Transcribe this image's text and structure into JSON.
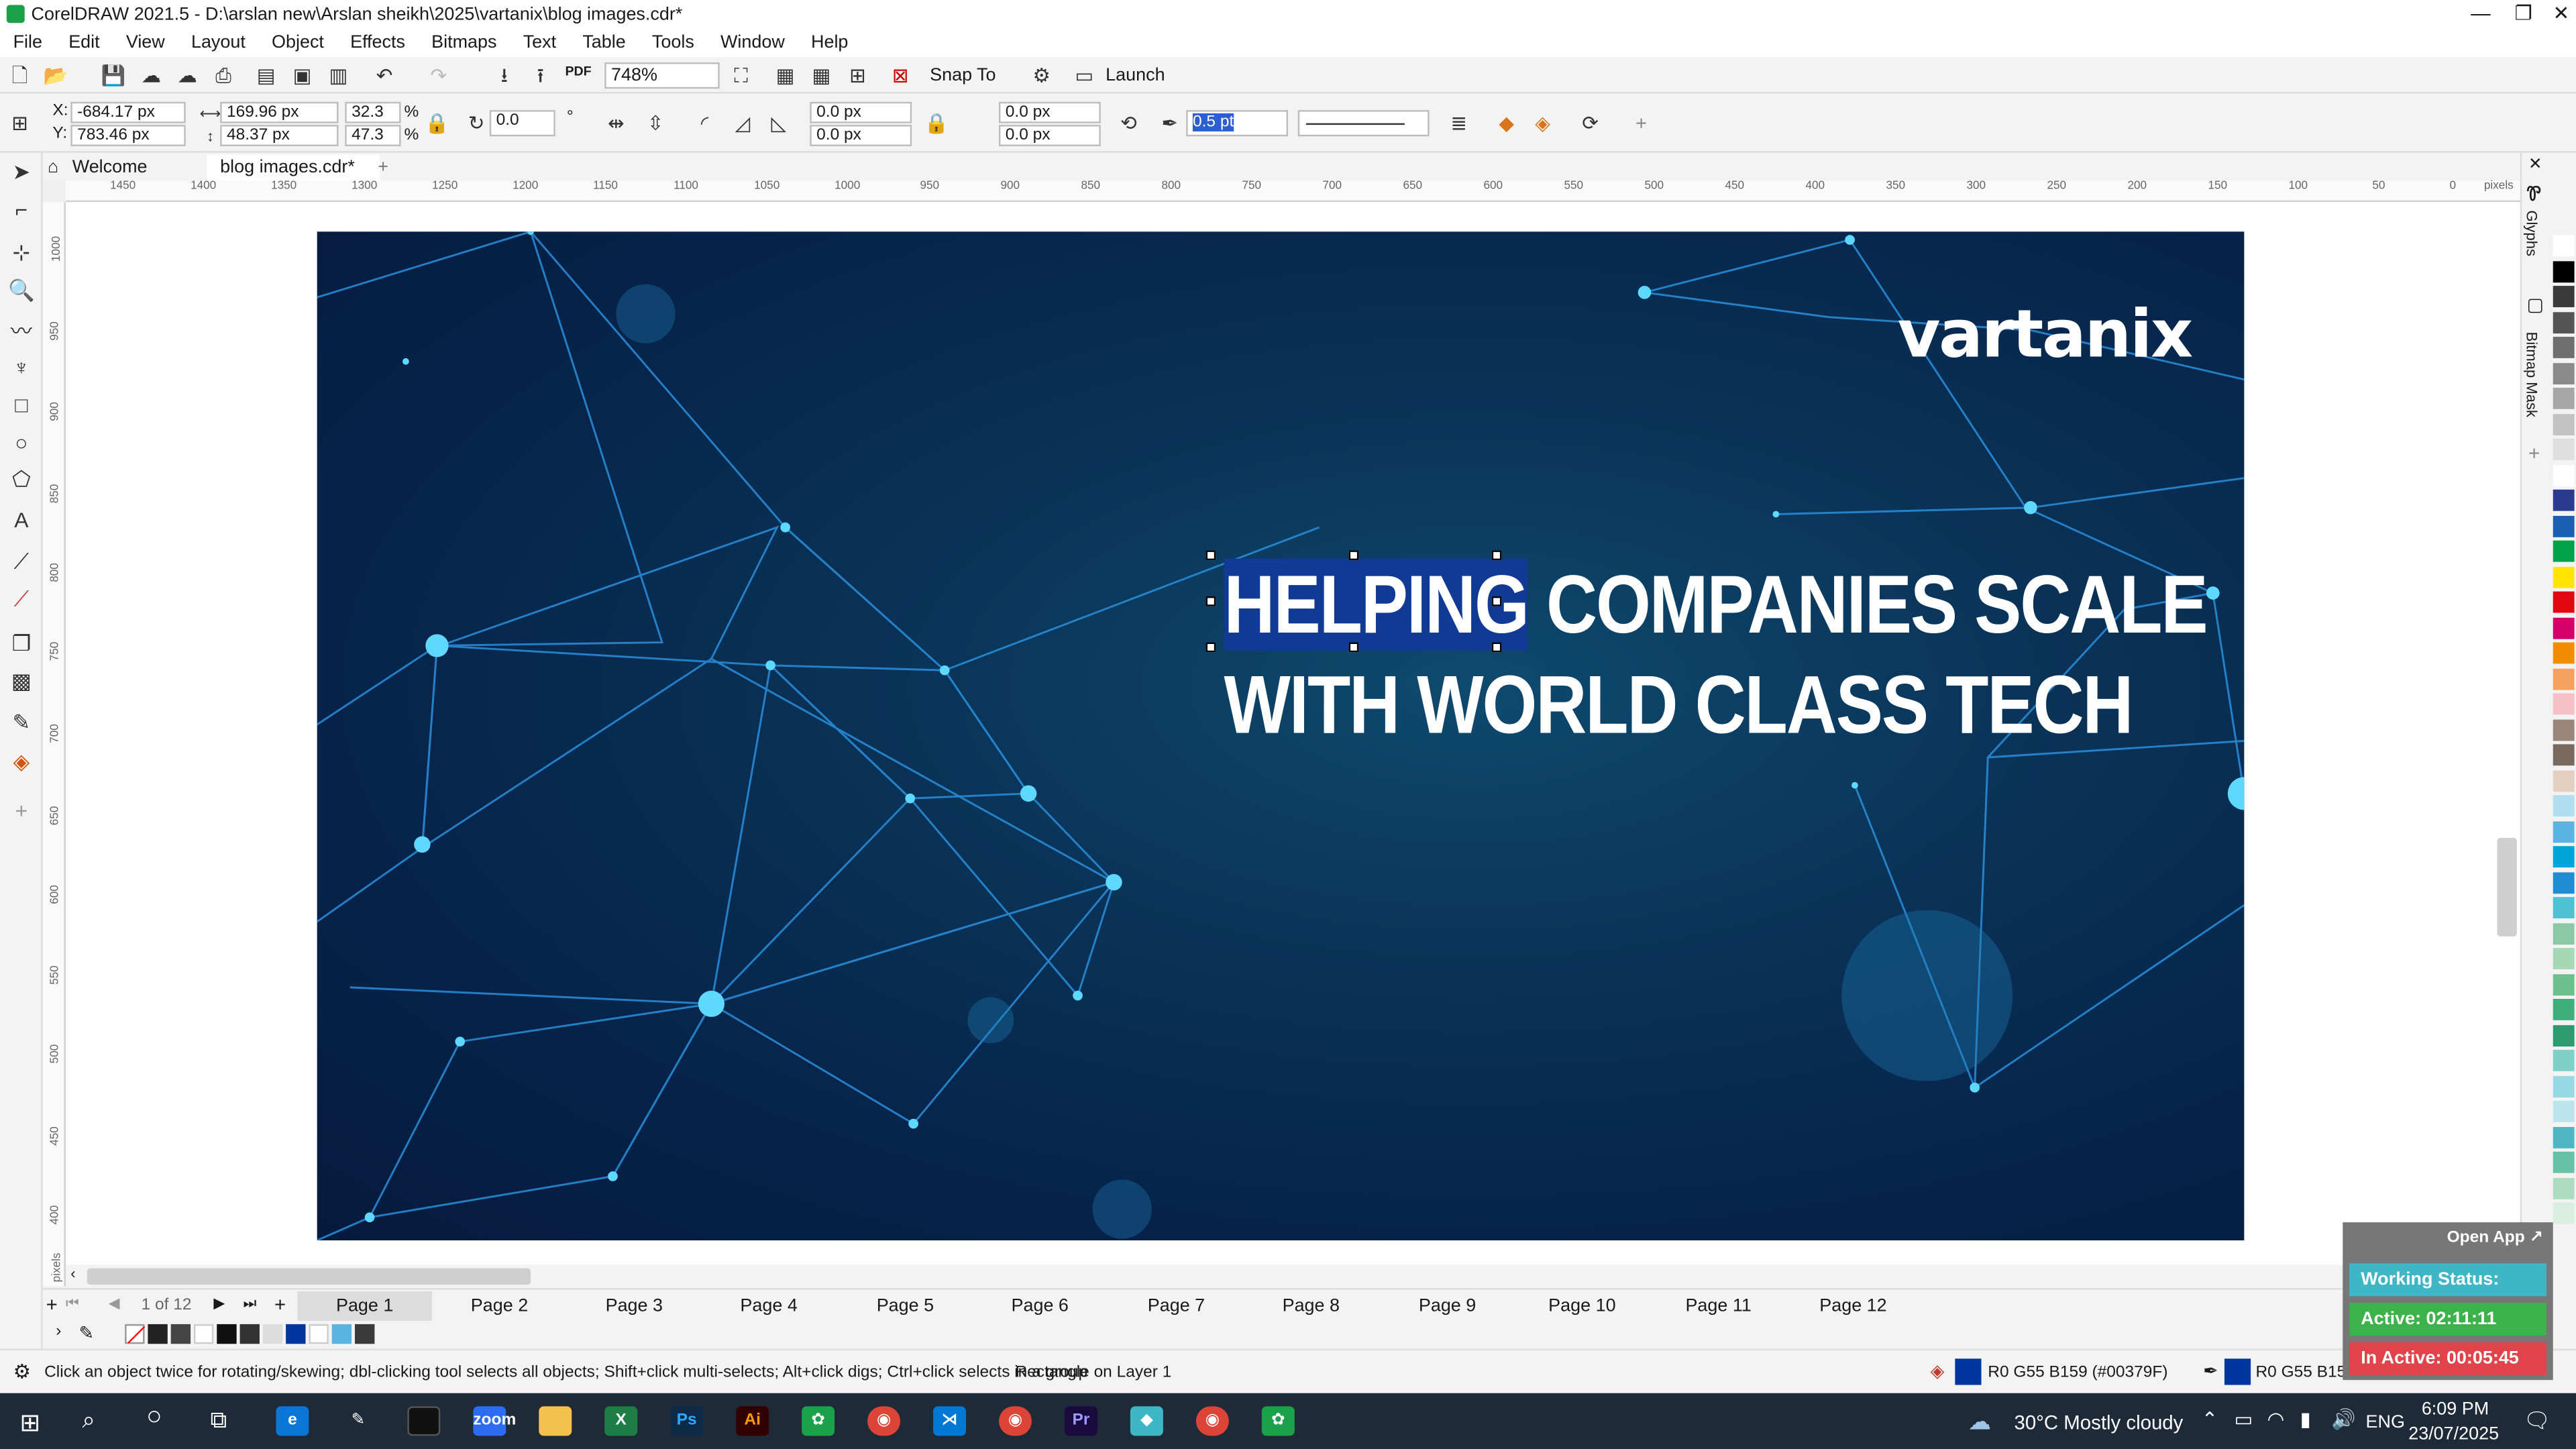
{
  "window": {
    "title": "CorelDRAW 2021.5 - D:\\arslan new\\Arslan sheikh\\2025\\vartanix\\blog images.cdr*",
    "controls": [
      "—",
      "❐",
      "✕"
    ]
  },
  "menu": [
    "File",
    "Edit",
    "View",
    "Layout",
    "Object",
    "Effects",
    "Bitmaps",
    "Text",
    "Table",
    "Tools",
    "Window",
    "Help"
  ],
  "toolbar": {
    "zoom": "748%",
    "snap_to": "Snap To",
    "launch": "Launch",
    "pdf_label": "PDF"
  },
  "property_bar": {
    "x": "-684.17 px",
    "y": "783.46 px",
    "x_label": "X:",
    "y_label": "Y:",
    "width": "169.96 px",
    "height": "48.37 px",
    "scale_w": "32.3",
    "scale_h": "47.3",
    "percent": "%",
    "rotation": "0.0",
    "degree": "°",
    "pos_a1": "0.0 px",
    "pos_a2": "0.0 px",
    "pos_b1": "0.0 px",
    "pos_b2": "0.0 px",
    "outline_width": "0.5 pt"
  },
  "doc_tabs": [
    "Welcome Screen",
    "blog images.cdr*"
  ],
  "ruler_h": [
    "1450",
    "1400",
    "1350",
    "1300",
    "1250",
    "1200",
    "1150",
    "1100",
    "1050",
    "1000",
    "950",
    "900",
    "850",
    "800",
    "750",
    "700",
    "650",
    "600",
    "550",
    "500",
    "450",
    "400",
    "350",
    "300",
    "250",
    "200",
    "150",
    "100",
    "50",
    "0"
  ],
  "ruler_h_unit": "pixels",
  "ruler_v": [
    "1000",
    "950",
    "900",
    "850",
    "800",
    "750",
    "700",
    "650",
    "600",
    "550",
    "500",
    "450",
    "400"
  ],
  "ruler_v_unit": "pixels",
  "artboard": {
    "logo": "vartanix",
    "headline_line1_selected": "HELPING",
    "headline_line1_rest": "COMPANIES SCALE",
    "headline_line2": "WITH WORLD CLASS TECH"
  },
  "pages": {
    "counter": "1 of 12",
    "tabs": [
      "Page 1",
      "Page 2",
      "Page 3",
      "Page 4",
      "Page 5",
      "Page 6",
      "Page 7",
      "Page 8",
      "Page 9",
      "Page 10",
      "Page 11",
      "Page 12"
    ],
    "active": "Page 1"
  },
  "status": {
    "hint": "Click an object twice for rotating/skewing; dbl-clicking tool selects all objects; Shift+click multi-selects; Alt+click digs; Ctrl+click selects in a group",
    "object": "Rectangle on Layer 1",
    "fill": "R0 G55 B159 (#00379F)",
    "outline": "R0 G55 B159",
    "fill_color": "#00379F"
  },
  "docker": {
    "glyphs": "Glyphs",
    "bitmap_mask": "Bitmap Mask"
  },
  "tracker": {
    "open_app": "Open App ↗",
    "working_status": "Working Status: Active",
    "active": "Active: 02:11:11",
    "inactive": "In Active: 00:05:45"
  },
  "taskbar": {
    "weather": "30°C  Mostly cloudy",
    "lang": "ENG",
    "time": "6:09 PM",
    "date": "23/07/2025",
    "apps": [
      "zoom",
      "Ps",
      "Ai",
      "Pr"
    ]
  },
  "palette_colors": [
    "#ffffff",
    "#000000",
    "#3a3a3a",
    "#555555",
    "#6e6e6e",
    "#8a8a8a",
    "#a6a6a6",
    "#c2c2c2",
    "#dedede",
    "#ffffff",
    "#2b3b8f",
    "#1b5fb3",
    "#00a14b",
    "#ffe600",
    "#e30613",
    "#d6006a",
    "#f08d00",
    "#f4a261",
    "#f7c0c8",
    "#9b8579",
    "#7a6a5e",
    "#e4cfc0",
    "#b0e0f0",
    "#5ab3e0",
    "#00a4d6",
    "#1f8bd1",
    "#4ec2d2",
    "#89c9a5",
    "#a5d8b5",
    "#6cc08b",
    "#3fae7a",
    "#2d9a6f",
    "#7fd0c8",
    "#98d7e4",
    "#bde4ec",
    "#4fb6c6",
    "#66c2a5",
    "#aedcc0",
    "#d9efe1"
  ]
}
